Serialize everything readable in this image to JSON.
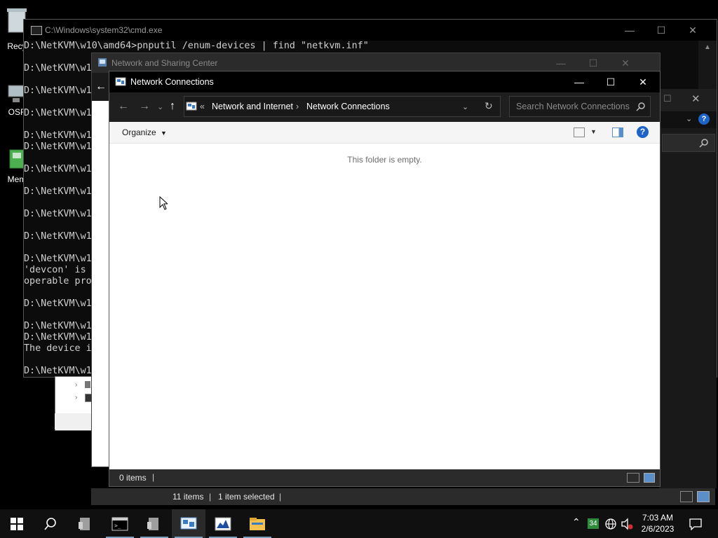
{
  "desktop": {
    "icons": [
      {
        "label": "Recy",
        "icon": "recycle-bin-icon"
      },
      {
        "label": "OSF",
        "icon": "computer-icon"
      },
      {
        "label": "Mem",
        "icon": "memory-icon"
      }
    ]
  },
  "cmd": {
    "title": "C:\\Windows\\system32\\cmd.exe",
    "lines": [
      "D:\\NetKVM\\w10\\amd64>pnputil /enum-devices | find \"netkvm.inf\"",
      "",
      "D:\\NetKVM\\w1",
      "",
      "D:\\NetKVM\\w1",
      "",
      "D:\\NetKVM\\w1",
      "",
      "D:\\NetKVM\\w1",
      "D:\\NetKVM\\w1",
      "",
      "D:\\NetKVM\\w1",
      "",
      "D:\\NetKVM\\w1",
      "",
      "D:\\NetKVM\\w1",
      "",
      "D:\\NetKVM\\w1",
      "",
      "D:\\NetKVM\\w1",
      "'devcon' is",
      "operable pro",
      "",
      "D:\\NetKVM\\w1",
      "",
      "D:\\NetKVM\\w1",
      "D:\\NetKVM\\w1",
      "The device i",
      "",
      "D:\\NetKVM\\w1"
    ]
  },
  "nsc": {
    "title": "Network and Sharing Center",
    "status_items": "11 items",
    "status_selected": "1 item selected"
  },
  "nc": {
    "title": "Network Connections",
    "breadcrumb_overflow": "«",
    "breadcrumb": [
      "Network and Internet",
      "Network Connections"
    ],
    "search_placeholder": "Search Network Connections",
    "organize_label": "Organize",
    "empty_message": "This folder is empty.",
    "status_items": "0 items"
  },
  "taskbar": {
    "clock_time": "7:03 AM",
    "clock_date": "2/6/2023",
    "tray_badge": "34",
    "apps": [
      "server-manager-icon",
      "command-prompt-icon",
      "server-manager-2-icon",
      "network-connections-icon",
      "task-manager-icon",
      "file-explorer-icon"
    ]
  },
  "colors": {
    "accent": "#1a73e8",
    "help": "#1e64c8",
    "taskbar": "#101010"
  }
}
